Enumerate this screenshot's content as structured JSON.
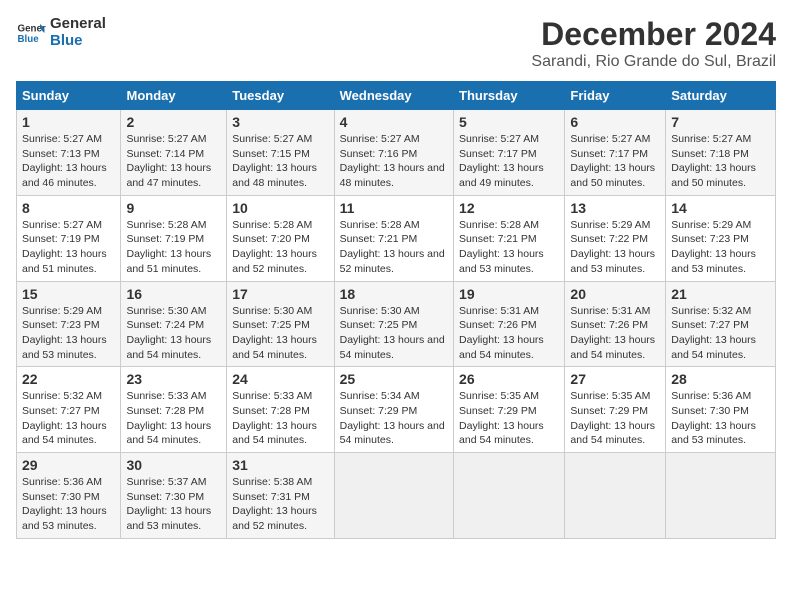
{
  "header": {
    "logo_line1": "General",
    "logo_line2": "Blue",
    "title": "December 2024",
    "subtitle": "Sarandi, Rio Grande do Sul, Brazil"
  },
  "weekdays": [
    "Sunday",
    "Monday",
    "Tuesday",
    "Wednesday",
    "Thursday",
    "Friday",
    "Saturday"
  ],
  "weeks": [
    [
      {
        "day": "1",
        "sunrise": "Sunrise: 5:27 AM",
        "sunset": "Sunset: 7:13 PM",
        "daylight": "Daylight: 13 hours and 46 minutes."
      },
      {
        "day": "2",
        "sunrise": "Sunrise: 5:27 AM",
        "sunset": "Sunset: 7:14 PM",
        "daylight": "Daylight: 13 hours and 47 minutes."
      },
      {
        "day": "3",
        "sunrise": "Sunrise: 5:27 AM",
        "sunset": "Sunset: 7:15 PM",
        "daylight": "Daylight: 13 hours and 48 minutes."
      },
      {
        "day": "4",
        "sunrise": "Sunrise: 5:27 AM",
        "sunset": "Sunset: 7:16 PM",
        "daylight": "Daylight: 13 hours and 48 minutes."
      },
      {
        "day": "5",
        "sunrise": "Sunrise: 5:27 AM",
        "sunset": "Sunset: 7:17 PM",
        "daylight": "Daylight: 13 hours and 49 minutes."
      },
      {
        "day": "6",
        "sunrise": "Sunrise: 5:27 AM",
        "sunset": "Sunset: 7:17 PM",
        "daylight": "Daylight: 13 hours and 50 minutes."
      },
      {
        "day": "7",
        "sunrise": "Sunrise: 5:27 AM",
        "sunset": "Sunset: 7:18 PM",
        "daylight": "Daylight: 13 hours and 50 minutes."
      }
    ],
    [
      {
        "day": "8",
        "sunrise": "Sunrise: 5:27 AM",
        "sunset": "Sunset: 7:19 PM",
        "daylight": "Daylight: 13 hours and 51 minutes."
      },
      {
        "day": "9",
        "sunrise": "Sunrise: 5:28 AM",
        "sunset": "Sunset: 7:19 PM",
        "daylight": "Daylight: 13 hours and 51 minutes."
      },
      {
        "day": "10",
        "sunrise": "Sunrise: 5:28 AM",
        "sunset": "Sunset: 7:20 PM",
        "daylight": "Daylight: 13 hours and 52 minutes."
      },
      {
        "day": "11",
        "sunrise": "Sunrise: 5:28 AM",
        "sunset": "Sunset: 7:21 PM",
        "daylight": "Daylight: 13 hours and 52 minutes."
      },
      {
        "day": "12",
        "sunrise": "Sunrise: 5:28 AM",
        "sunset": "Sunset: 7:21 PM",
        "daylight": "Daylight: 13 hours and 53 minutes."
      },
      {
        "day": "13",
        "sunrise": "Sunrise: 5:29 AM",
        "sunset": "Sunset: 7:22 PM",
        "daylight": "Daylight: 13 hours and 53 minutes."
      },
      {
        "day": "14",
        "sunrise": "Sunrise: 5:29 AM",
        "sunset": "Sunset: 7:23 PM",
        "daylight": "Daylight: 13 hours and 53 minutes."
      }
    ],
    [
      {
        "day": "15",
        "sunrise": "Sunrise: 5:29 AM",
        "sunset": "Sunset: 7:23 PM",
        "daylight": "Daylight: 13 hours and 53 minutes."
      },
      {
        "day": "16",
        "sunrise": "Sunrise: 5:30 AM",
        "sunset": "Sunset: 7:24 PM",
        "daylight": "Daylight: 13 hours and 54 minutes."
      },
      {
        "day": "17",
        "sunrise": "Sunrise: 5:30 AM",
        "sunset": "Sunset: 7:25 PM",
        "daylight": "Daylight: 13 hours and 54 minutes."
      },
      {
        "day": "18",
        "sunrise": "Sunrise: 5:30 AM",
        "sunset": "Sunset: 7:25 PM",
        "daylight": "Daylight: 13 hours and 54 minutes."
      },
      {
        "day": "19",
        "sunrise": "Sunrise: 5:31 AM",
        "sunset": "Sunset: 7:26 PM",
        "daylight": "Daylight: 13 hours and 54 minutes."
      },
      {
        "day": "20",
        "sunrise": "Sunrise: 5:31 AM",
        "sunset": "Sunset: 7:26 PM",
        "daylight": "Daylight: 13 hours and 54 minutes."
      },
      {
        "day": "21",
        "sunrise": "Sunrise: 5:32 AM",
        "sunset": "Sunset: 7:27 PM",
        "daylight": "Daylight: 13 hours and 54 minutes."
      }
    ],
    [
      {
        "day": "22",
        "sunrise": "Sunrise: 5:32 AM",
        "sunset": "Sunset: 7:27 PM",
        "daylight": "Daylight: 13 hours and 54 minutes."
      },
      {
        "day": "23",
        "sunrise": "Sunrise: 5:33 AM",
        "sunset": "Sunset: 7:28 PM",
        "daylight": "Daylight: 13 hours and 54 minutes."
      },
      {
        "day": "24",
        "sunrise": "Sunrise: 5:33 AM",
        "sunset": "Sunset: 7:28 PM",
        "daylight": "Daylight: 13 hours and 54 minutes."
      },
      {
        "day": "25",
        "sunrise": "Sunrise: 5:34 AM",
        "sunset": "Sunset: 7:29 PM",
        "daylight": "Daylight: 13 hours and 54 minutes."
      },
      {
        "day": "26",
        "sunrise": "Sunrise: 5:35 AM",
        "sunset": "Sunset: 7:29 PM",
        "daylight": "Daylight: 13 hours and 54 minutes."
      },
      {
        "day": "27",
        "sunrise": "Sunrise: 5:35 AM",
        "sunset": "Sunset: 7:29 PM",
        "daylight": "Daylight: 13 hours and 54 minutes."
      },
      {
        "day": "28",
        "sunrise": "Sunrise: 5:36 AM",
        "sunset": "Sunset: 7:30 PM",
        "daylight": "Daylight: 13 hours and 53 minutes."
      }
    ],
    [
      {
        "day": "29",
        "sunrise": "Sunrise: 5:36 AM",
        "sunset": "Sunset: 7:30 PM",
        "daylight": "Daylight: 13 hours and 53 minutes."
      },
      {
        "day": "30",
        "sunrise": "Sunrise: 5:37 AM",
        "sunset": "Sunset: 7:30 PM",
        "daylight": "Daylight: 13 hours and 53 minutes."
      },
      {
        "day": "31",
        "sunrise": "Sunrise: 5:38 AM",
        "sunset": "Sunset: 7:31 PM",
        "daylight": "Daylight: 13 hours and 52 minutes."
      },
      null,
      null,
      null,
      null
    ]
  ]
}
